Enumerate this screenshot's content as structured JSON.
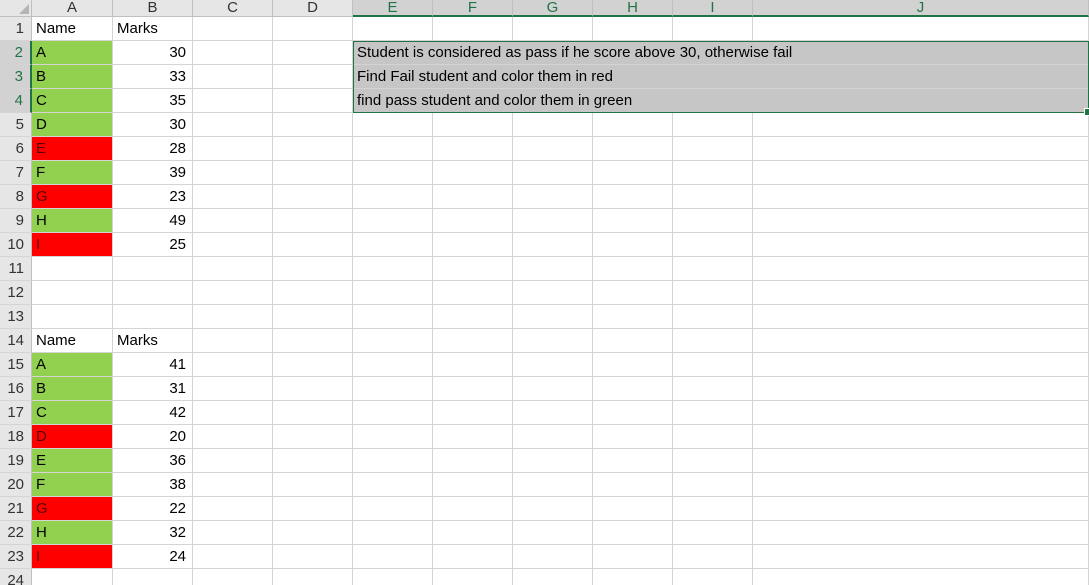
{
  "columns": [
    "A",
    "B",
    "C",
    "D",
    "E",
    "F",
    "G",
    "H",
    "I",
    "J"
  ],
  "selected_columns": [
    "E",
    "F",
    "G",
    "H",
    "I",
    "J"
  ],
  "rows": [
    {
      "num": "1",
      "name": "Name",
      "marks": "Marks",
      "fill": "none",
      "header": true
    },
    {
      "num": "2",
      "name": "A",
      "marks": "30",
      "fill": "green"
    },
    {
      "num": "3",
      "name": "B",
      "marks": "33",
      "fill": "green"
    },
    {
      "num": "4",
      "name": "C",
      "marks": "35",
      "fill": "green"
    },
    {
      "num": "5",
      "name": "D",
      "marks": "30",
      "fill": "green"
    },
    {
      "num": "6",
      "name": "E",
      "marks": "28",
      "fill": "red"
    },
    {
      "num": "7",
      "name": "F",
      "marks": "39",
      "fill": "green"
    },
    {
      "num": "8",
      "name": "G",
      "marks": "23",
      "fill": "red"
    },
    {
      "num": "9",
      "name": "H",
      "marks": "49",
      "fill": "green"
    },
    {
      "num": "10",
      "name": "I",
      "marks": "25",
      "fill": "red"
    },
    {
      "num": "11",
      "name": "",
      "marks": "",
      "fill": "none"
    },
    {
      "num": "12",
      "name": "",
      "marks": "",
      "fill": "none"
    },
    {
      "num": "13",
      "name": "",
      "marks": "",
      "fill": "none"
    },
    {
      "num": "14",
      "name": "Name",
      "marks": "Marks",
      "fill": "none",
      "header": true
    },
    {
      "num": "15",
      "name": "A",
      "marks": "41",
      "fill": "green"
    },
    {
      "num": "16",
      "name": "B",
      "marks": "31",
      "fill": "green"
    },
    {
      "num": "17",
      "name": "C",
      "marks": "42",
      "fill": "green"
    },
    {
      "num": "18",
      "name": "D",
      "marks": "20",
      "fill": "red"
    },
    {
      "num": "19",
      "name": "E",
      "marks": "36",
      "fill": "green"
    },
    {
      "num": "20",
      "name": "F",
      "marks": "38",
      "fill": "green"
    },
    {
      "num": "21",
      "name": "G",
      "marks": "22",
      "fill": "red"
    },
    {
      "num": "22",
      "name": "H",
      "marks": "32",
      "fill": "green"
    },
    {
      "num": "23",
      "name": "I",
      "marks": "24",
      "fill": "red"
    },
    {
      "num": "24",
      "name": "",
      "marks": "",
      "fill": "none"
    }
  ],
  "selected_rows": [
    "2",
    "3",
    "4"
  ],
  "notes": [
    "Student is considered as pass if he score above 30, otherwise fail",
    "Find Fail student and color them in red",
    "find pass student and color them in green"
  ],
  "colors": {
    "pass_green": "#92d050",
    "fail_red": "#ff0000",
    "selection_border": "#217346",
    "selection_fill": "#c6c6c6"
  }
}
